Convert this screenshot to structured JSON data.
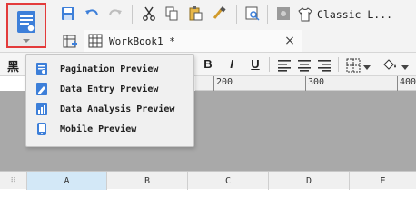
{
  "toolbar": {
    "theme_label": "Classic L...",
    "icons": [
      "save-icon",
      "undo-icon",
      "redo-icon",
      "cut-icon",
      "copy-icon",
      "paste-icon",
      "format-painter-icon",
      "search-icon",
      "style-icon",
      "shirt-icon"
    ]
  },
  "tab": {
    "title": "WorkBook1 *",
    "close": "×"
  },
  "preview_menu": {
    "items": [
      {
        "label": "Pagination Preview"
      },
      {
        "label": "Data Entry Preview"
      },
      {
        "label": "Data Analysis Preview"
      },
      {
        "label": "Mobile Preview"
      }
    ]
  },
  "format_bar": {
    "bold": "B",
    "italic": "I",
    "underline": "U"
  },
  "ruler": {
    "labels": [
      "200",
      "300",
      "400"
    ]
  },
  "sheet": {
    "columns": [
      "A",
      "B",
      "C",
      "D",
      "E"
    ]
  },
  "colors": {
    "accent": "#3d7fd9",
    "highlight_border": "#e33b3b",
    "canvas": "#a9a9a9",
    "selected_column": "#d3e8f7"
  }
}
